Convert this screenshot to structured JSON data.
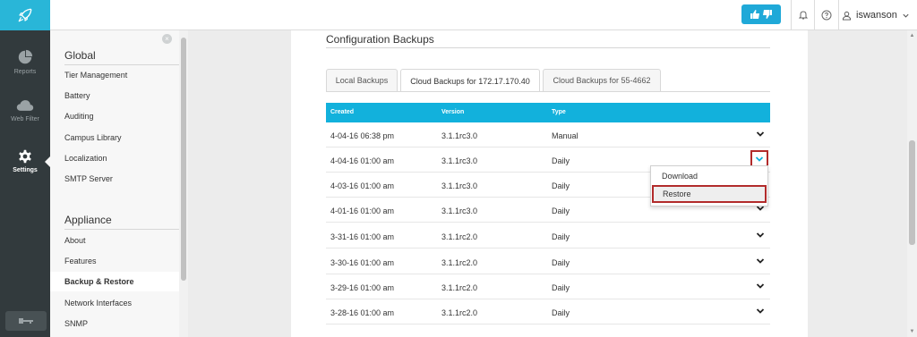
{
  "topbar": {
    "username": "iswanson"
  },
  "leftnav": {
    "items": [
      {
        "label": "Reports",
        "icon": "pie-chart-icon"
      },
      {
        "label": "Web Filter",
        "icon": "cloud-icon"
      },
      {
        "label": "Settings",
        "icon": "gear-icon"
      }
    ]
  },
  "menu": {
    "global_heading": "Global",
    "global_items": [
      "Tier Management",
      "Battery",
      "Auditing",
      "Campus Library",
      "Localization",
      "SMTP Server"
    ],
    "appliance_heading": "Appliance",
    "appliance_items": [
      "About",
      "Features",
      "Backup & Restore",
      "Network Interfaces",
      "SNMP"
    ],
    "selected": "Backup & Restore"
  },
  "main": {
    "title": "Configuration Backups",
    "tabs": [
      {
        "label": "Local Backups"
      },
      {
        "label": "Cloud Backups for 172.17.170.40"
      },
      {
        "label": "Cloud Backups for 55-4662"
      }
    ],
    "active_tab": 1,
    "table": {
      "headers": [
        "Created",
        "Version",
        "Type"
      ],
      "rows": [
        {
          "created": "4-04-16 06:38 pm",
          "version": "3.1.1rc3.0",
          "type": "Manual"
        },
        {
          "created": "4-04-16 01:00 am",
          "version": "3.1.1rc3.0",
          "type": "Daily"
        },
        {
          "created": "4-03-16 01:00 am",
          "version": "3.1.1rc3.0",
          "type": "Daily"
        },
        {
          "created": "4-01-16 01:00 am",
          "version": "3.1.1rc3.0",
          "type": "Daily"
        },
        {
          "created": "3-31-16 01:00 am",
          "version": "3.1.1rc2.0",
          "type": "Daily"
        },
        {
          "created": "3-30-16 01:00 am",
          "version": "3.1.1rc2.0",
          "type": "Daily"
        },
        {
          "created": "3-29-16 01:00 am",
          "version": "3.1.1rc2.0",
          "type": "Daily"
        },
        {
          "created": "3-28-16 01:00 am",
          "version": "3.1.1rc2.0",
          "type": "Daily"
        }
      ]
    },
    "dropdown": {
      "items": [
        "Download",
        "Restore"
      ]
    }
  },
  "colors": {
    "brand": "#29b6d8",
    "table_header": "#12b1dc",
    "highlight_border": "#b22b2b",
    "nav_bg": "#323a3d"
  }
}
